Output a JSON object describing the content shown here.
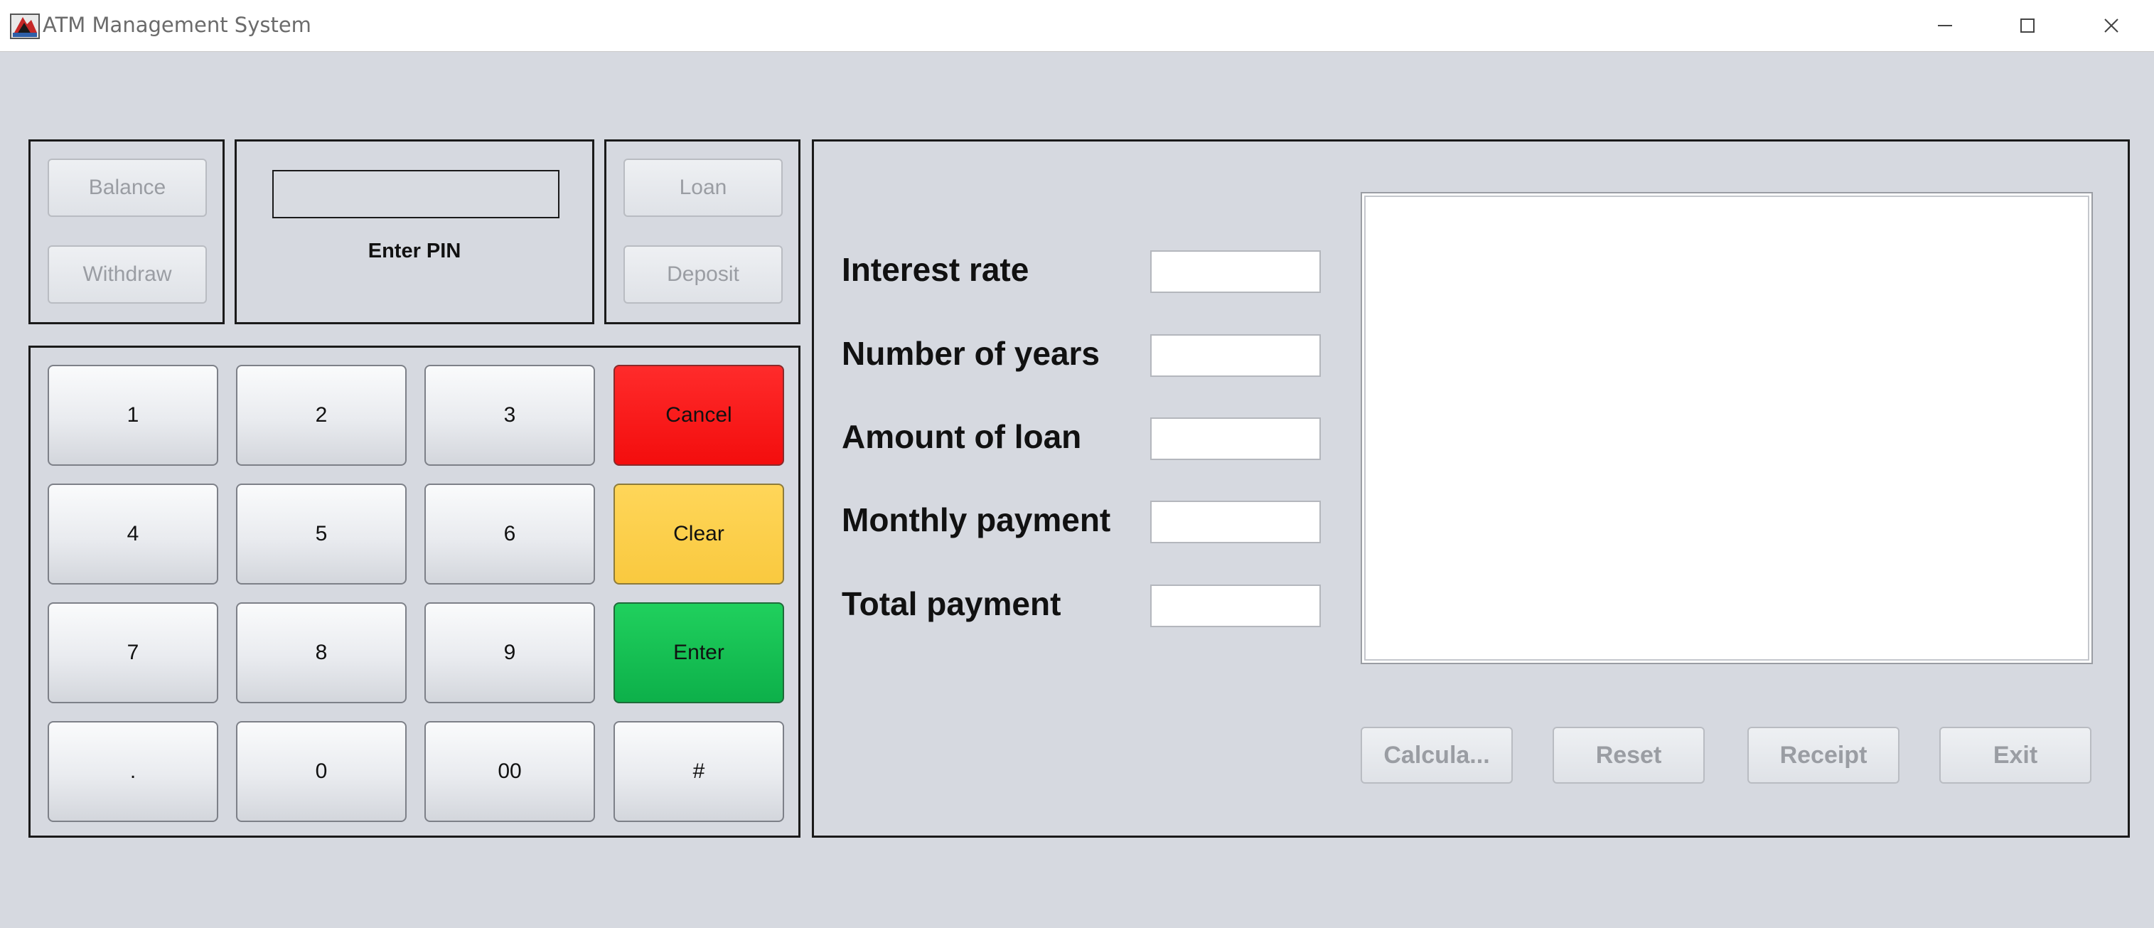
{
  "window": {
    "title": "ATM Management System",
    "icon": "atm-app-icon"
  },
  "account_buttons": {
    "balance": "Balance",
    "withdraw": "Withdraw",
    "loan": "Loan",
    "deposit": "Deposit"
  },
  "pin": {
    "label": "Enter PIN",
    "value": ""
  },
  "keypad": {
    "keys": [
      "1",
      "2",
      "3",
      "Cancel",
      "4",
      "5",
      "6",
      "Clear",
      "7",
      "8",
      "9",
      "Enter",
      ".",
      "0",
      "00",
      "#"
    ],
    "colors": {
      "cancel": "#f51414",
      "clear": "#fbcd47",
      "enter": "#12c04f"
    }
  },
  "loan_form": {
    "fields": [
      {
        "label": "Interest rate",
        "value": ""
      },
      {
        "label": "Number of years",
        "value": ""
      },
      {
        "label": "Amount of loan",
        "value": ""
      },
      {
        "label": "Monthly payment",
        "value": ""
      },
      {
        "label": "Total payment",
        "value": ""
      }
    ],
    "receipt_text": "",
    "buttons": [
      "Calcula...",
      "Reset",
      "Receipt",
      "Exit"
    ]
  }
}
